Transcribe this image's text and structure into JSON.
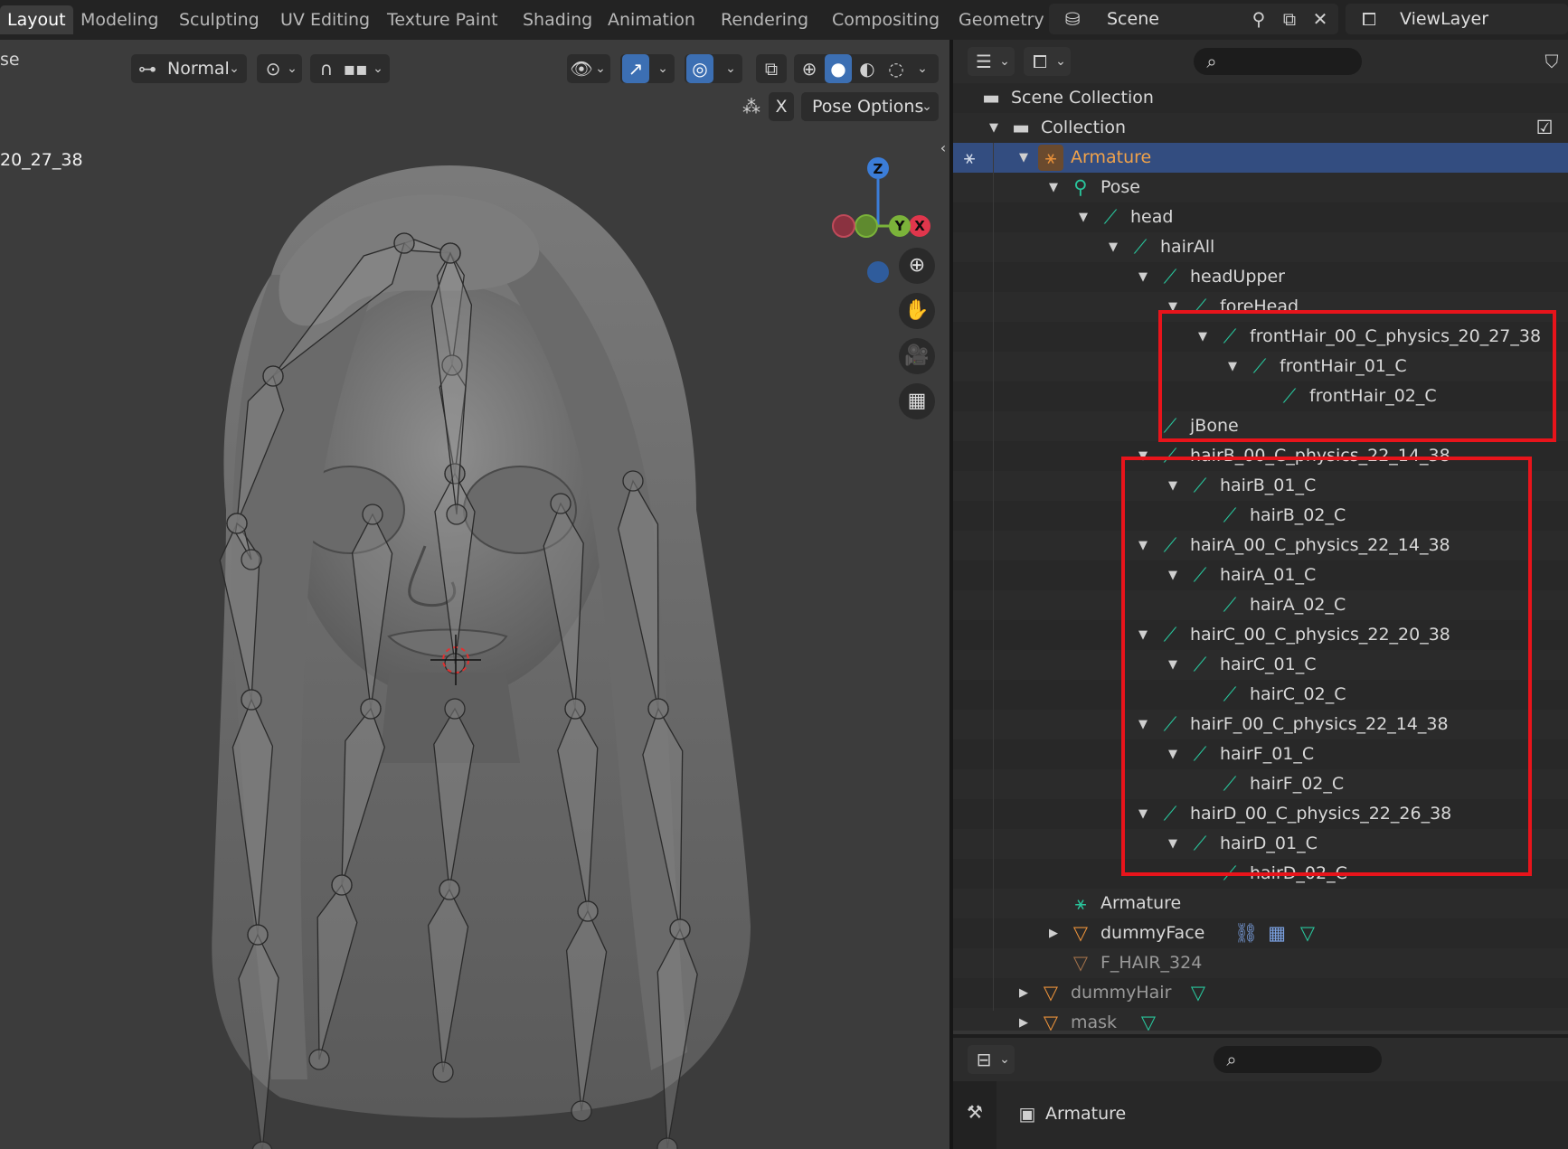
{
  "topbar": {
    "tabs": [
      {
        "label": "Layout",
        "active": true
      },
      {
        "label": "Modeling"
      },
      {
        "label": "Sculpting"
      },
      {
        "label": "UV Editing"
      },
      {
        "label": "Texture Paint"
      },
      {
        "label": "Shading"
      },
      {
        "label": "Animation"
      },
      {
        "label": "Rendering"
      },
      {
        "label": "Compositing"
      },
      {
        "label": "Geometry"
      }
    ],
    "scene": "Scene",
    "view_layer": "ViewLayer"
  },
  "viewport": {
    "mode_left_text": "se",
    "transform_orientation": "Normal",
    "pose_options_label": "Pose Options",
    "x_label": "X",
    "overlay_text": "20_27_38",
    "gizmo": {
      "z": "Z",
      "y": "Y",
      "x": "X"
    }
  },
  "outliner": {
    "rows": [
      {
        "label": "Scene Collection",
        "depth": 0,
        "icon": "collection",
        "twisty": ""
      },
      {
        "label": "Collection",
        "depth": 1,
        "icon": "collection",
        "twisty": "▼",
        "checkbox": true
      },
      {
        "label": "Armature",
        "depth": 2,
        "icon": "armature",
        "twisty": "▼",
        "selected": true
      },
      {
        "label": "Pose",
        "depth": 3,
        "icon": "pose",
        "twisty": "▼"
      },
      {
        "label": "head",
        "depth": 4,
        "icon": "bone",
        "twisty": "▼"
      },
      {
        "label": "hairAll",
        "depth": 5,
        "icon": "bone",
        "twisty": "▼"
      },
      {
        "label": "headUpper",
        "depth": 6,
        "icon": "bone",
        "twisty": "▼"
      },
      {
        "label": "foreHead",
        "depth": 7,
        "icon": "bone",
        "twisty": "▼"
      },
      {
        "label": "frontHair_00_C_physics_20_27_38",
        "depth": 8,
        "icon": "bone",
        "twisty": "▼"
      },
      {
        "label": "frontHair_01_C",
        "depth": 9,
        "icon": "bone",
        "twisty": "▼"
      },
      {
        "label": "frontHair_02_C",
        "depth": 10,
        "icon": "bone",
        "twisty": ""
      },
      {
        "label": "jBone",
        "depth": 6,
        "icon": "bone",
        "twisty": ""
      },
      {
        "label": "hairB_00_C_physics_22_14_38",
        "depth": 6,
        "icon": "bone",
        "twisty": "▼"
      },
      {
        "label": "hairB_01_C",
        "depth": 7,
        "icon": "bone",
        "twisty": "▼"
      },
      {
        "label": "hairB_02_C",
        "depth": 8,
        "icon": "bone",
        "twisty": ""
      },
      {
        "label": "hairA_00_C_physics_22_14_38",
        "depth": 6,
        "icon": "bone",
        "twisty": "▼"
      },
      {
        "label": "hairA_01_C",
        "depth": 7,
        "icon": "bone",
        "twisty": "▼"
      },
      {
        "label": "hairA_02_C",
        "depth": 8,
        "icon": "bone",
        "twisty": ""
      },
      {
        "label": "hairC_00_C_physics_22_20_38",
        "depth": 6,
        "icon": "bone",
        "twisty": "▼"
      },
      {
        "label": "hairC_01_C",
        "depth": 7,
        "icon": "bone",
        "twisty": "▼"
      },
      {
        "label": "hairC_02_C",
        "depth": 8,
        "icon": "bone",
        "twisty": ""
      },
      {
        "label": "hairF_00_C_physics_22_14_38",
        "depth": 6,
        "icon": "bone",
        "twisty": "▼"
      },
      {
        "label": "hairF_01_C",
        "depth": 7,
        "icon": "bone",
        "twisty": "▼"
      },
      {
        "label": "hairF_02_C",
        "depth": 8,
        "icon": "bone",
        "twisty": ""
      },
      {
        "label": "hairD_00_C_physics_22_26_38",
        "depth": 6,
        "icon": "bone",
        "twisty": "▼"
      },
      {
        "label": "hairD_01_C",
        "depth": 7,
        "icon": "bone",
        "twisty": "▼"
      },
      {
        "label": "hairD_02_C",
        "depth": 8,
        "icon": "bone",
        "twisty": ""
      },
      {
        "label": "Armature",
        "depth": 3,
        "icon": "armature-data",
        "twisty": ""
      },
      {
        "label": "dummyFace",
        "depth": 3,
        "icon": "mesh",
        "twisty": "▶",
        "extras": true
      },
      {
        "label": "F_HAIR_324",
        "depth": 3,
        "icon": "mesh-dim",
        "twisty": "",
        "dim": true
      },
      {
        "label": "dummyHair",
        "depth": 2,
        "icon": "mesh",
        "twisty": "▶",
        "dim": true,
        "modifier": true
      },
      {
        "label": "mask",
        "depth": 2,
        "icon": "mesh",
        "twisty": "▶",
        "dim": true,
        "modifier": true
      }
    ]
  },
  "properties": {
    "object_name": "Armature"
  },
  "colors": {
    "selection": "#334d80",
    "bone": "#29c49b",
    "highlight": "#e8141b",
    "armature": "#e8903a"
  }
}
